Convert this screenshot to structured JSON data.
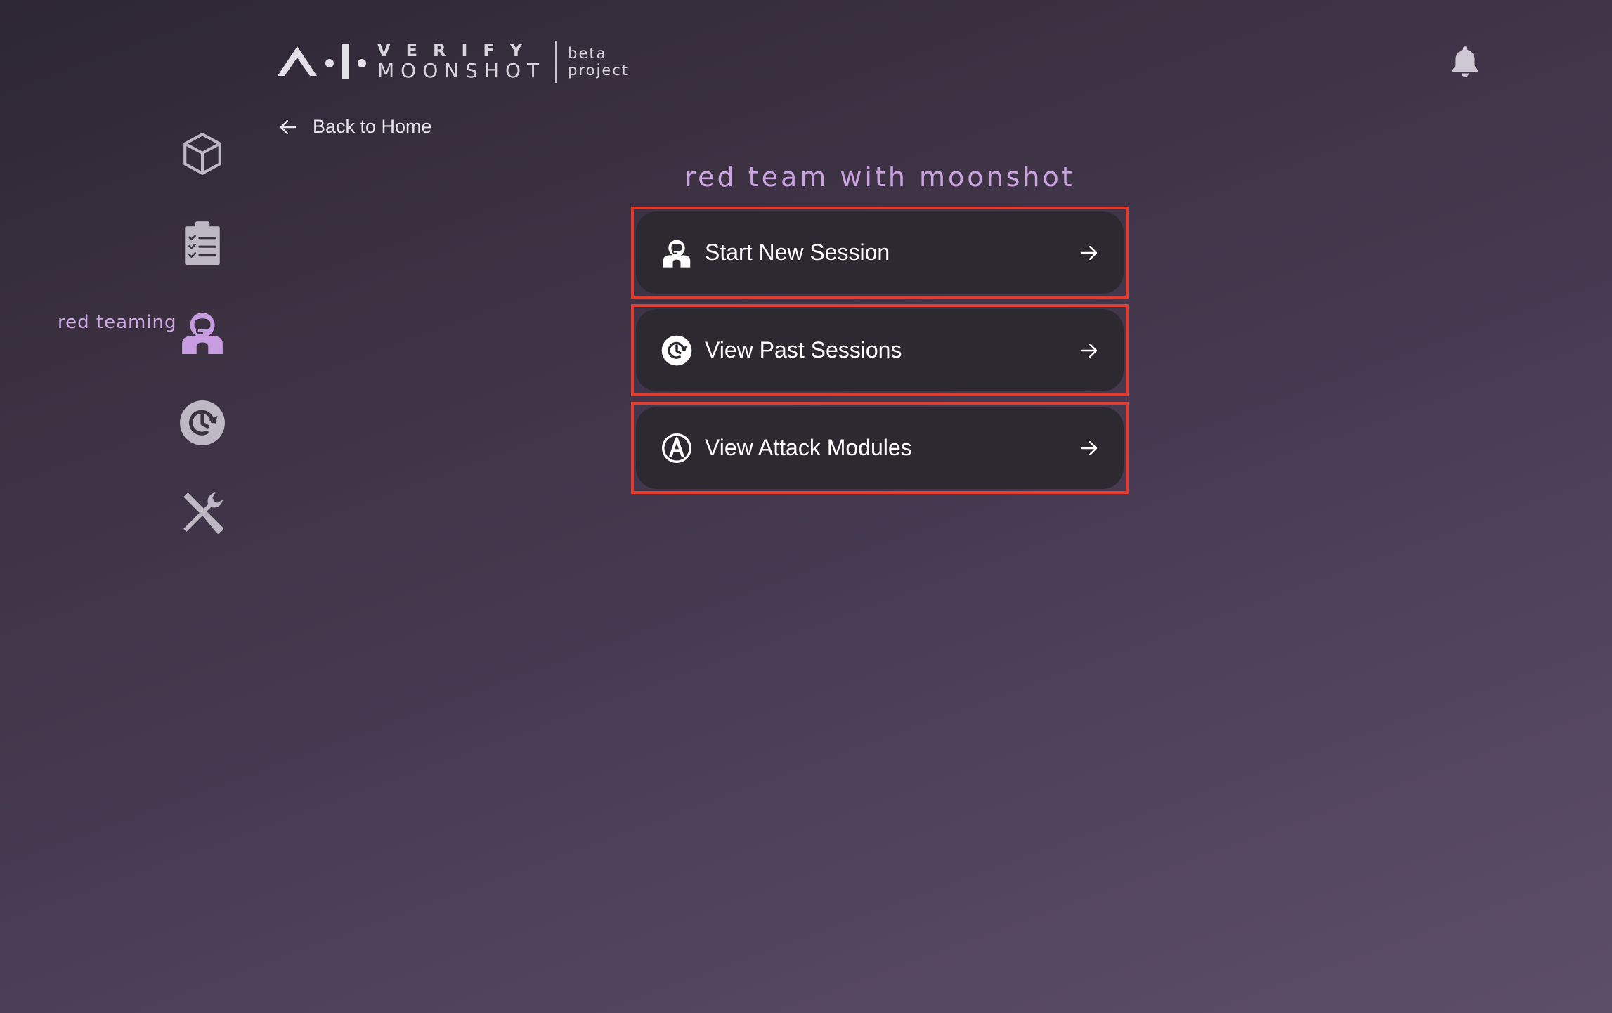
{
  "brand": {
    "line1": "VERIFY",
    "line2": "MOONSHOT",
    "tag_line1": "beta",
    "tag_line2": "project"
  },
  "nav": {
    "back_label": "Back to Home"
  },
  "sidebar": {
    "items": [
      {
        "id": "models",
        "icon": "cube-icon",
        "active": false
      },
      {
        "id": "benchmarks",
        "icon": "clipboard-list-icon",
        "active": false
      },
      {
        "id": "red-teaming",
        "icon": "astronaut-icon",
        "active": true,
        "label": "red teaming"
      },
      {
        "id": "history",
        "icon": "history-icon",
        "active": false
      },
      {
        "id": "utilities",
        "icon": "tools-icon",
        "active": false
      }
    ]
  },
  "main": {
    "title": "red team with moonshot",
    "actions": [
      {
        "label": "Start New Session",
        "icon": "astronaut-icon"
      },
      {
        "label": "View Past Sessions",
        "icon": "history-icon"
      },
      {
        "label": "View Attack Modules",
        "icon": "attack-module-icon"
      }
    ]
  },
  "colors": {
    "accent": "#c79ce0",
    "highlight_border": "#e03c2f",
    "button_bg": "#2c2a30"
  }
}
